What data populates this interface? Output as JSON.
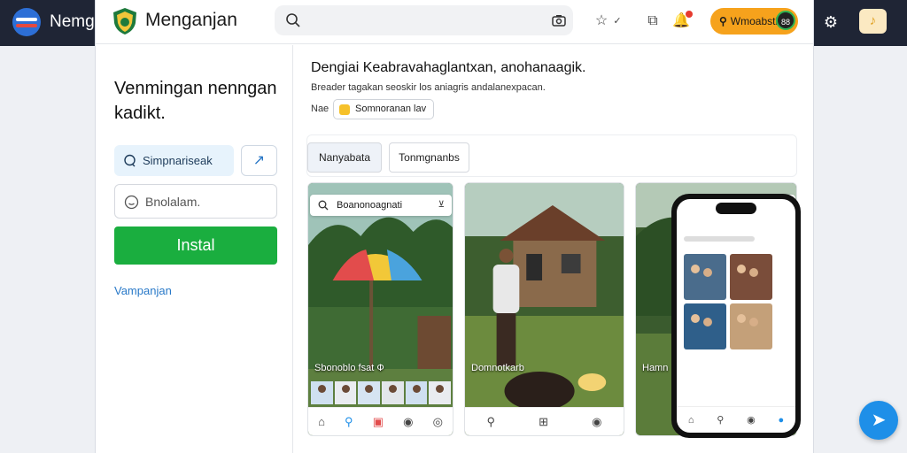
{
  "outer": {
    "title": "Nemgo",
    "right_icon": "gear-icon",
    "badge_label": "♪"
  },
  "app": {
    "name": "Menganjan",
    "search": {
      "value": "",
      "placeholder": ""
    },
    "promo": {
      "label": "Wmoabstb",
      "avatar": "88"
    }
  },
  "left": {
    "heading": "Venmingan nenngan kadikt.",
    "chip": "Simpnariseak",
    "input_placeholder": "Bnolalam.",
    "install_label": "Instal",
    "link": "Vampanjan"
  },
  "content": {
    "title": "Dengiai Keabravahaglantxan, anohanaagik.",
    "subtitle": "Breader tagakan seoskir los aniagris andalanexpacan.",
    "by_label": "Nae",
    "tag": "Somnoranan lav",
    "tabs": [
      {
        "label": "Nanyabata"
      },
      {
        "label": "Tonmgnanbs"
      }
    ],
    "cards": [
      {
        "top_label": "Boanonoagnati",
        "caption": "Sbonoblo fsat Ф"
      },
      {
        "caption": "Domnotkarb"
      },
      {
        "caption": "Hamn"
      }
    ]
  },
  "colors": {
    "primary_green": "#1aae3f",
    "accent_orange": "#f6a21c",
    "fab_blue": "#1e8fe8",
    "chrome_dark": "#1f2535"
  }
}
